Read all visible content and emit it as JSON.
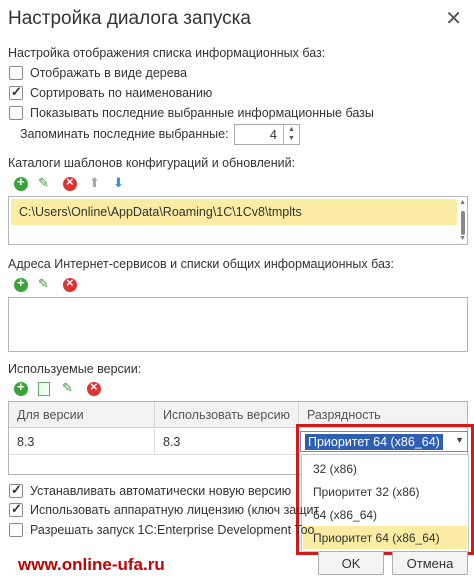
{
  "window": {
    "title": "Настройка диалога запуска"
  },
  "infobase_list": {
    "heading": "Настройка отображения списка информационных баз:",
    "tree_label": "Отображать в виде дерева",
    "tree_checked": false,
    "sort_label": "Сортировать по наименованию",
    "sort_checked": true,
    "recent_label": "Показывать последние выбранные информационные базы",
    "recent_checked": false,
    "remember_label": "Запоминать последние выбранные:",
    "remember_value": "4"
  },
  "templates": {
    "heading": "Каталоги шаблонов конфигураций и обновлений:",
    "paths": [
      "C:\\Users\\Online\\AppData\\Roaming\\1C\\1Cv8\\tmplts"
    ]
  },
  "services": {
    "heading": "Адреса Интернет-сервисов и списки общих информационных баз:"
  },
  "versions": {
    "heading": "Используемые версии:",
    "columns": [
      "Для версии",
      "Использовать версию",
      "Разрядность"
    ],
    "rows": [
      {
        "version": "8.3",
        "use_version": "8.3",
        "bitness": "Приоритет 64 (x86_64)"
      }
    ],
    "bitness_options": [
      "32 (x86)",
      "Приоритет 32 (x86)",
      "64 (x86_64)",
      "Приоритет 64 (x86_64)"
    ],
    "selected_option": "Приоритет 64 (x86_64)"
  },
  "bottom": {
    "auto_install_label": "Устанавливать автоматически новую версию",
    "auto_install_checked": true,
    "hw_license_label": "Использовать аппаратную лицензию (ключ защит",
    "hw_license_checked": true,
    "edt_label": "Разрешать запуск 1С:Enterprise Development Too",
    "edt_checked": false
  },
  "buttons": {
    "ok": "OK",
    "cancel": "Отмена"
  },
  "watermark": "www.online-ufa.ru",
  "colors": {
    "selection": "#fbeca3",
    "highlight": "#2f5fb3",
    "frame": "#d31a1a",
    "watermark": "#c40000"
  }
}
